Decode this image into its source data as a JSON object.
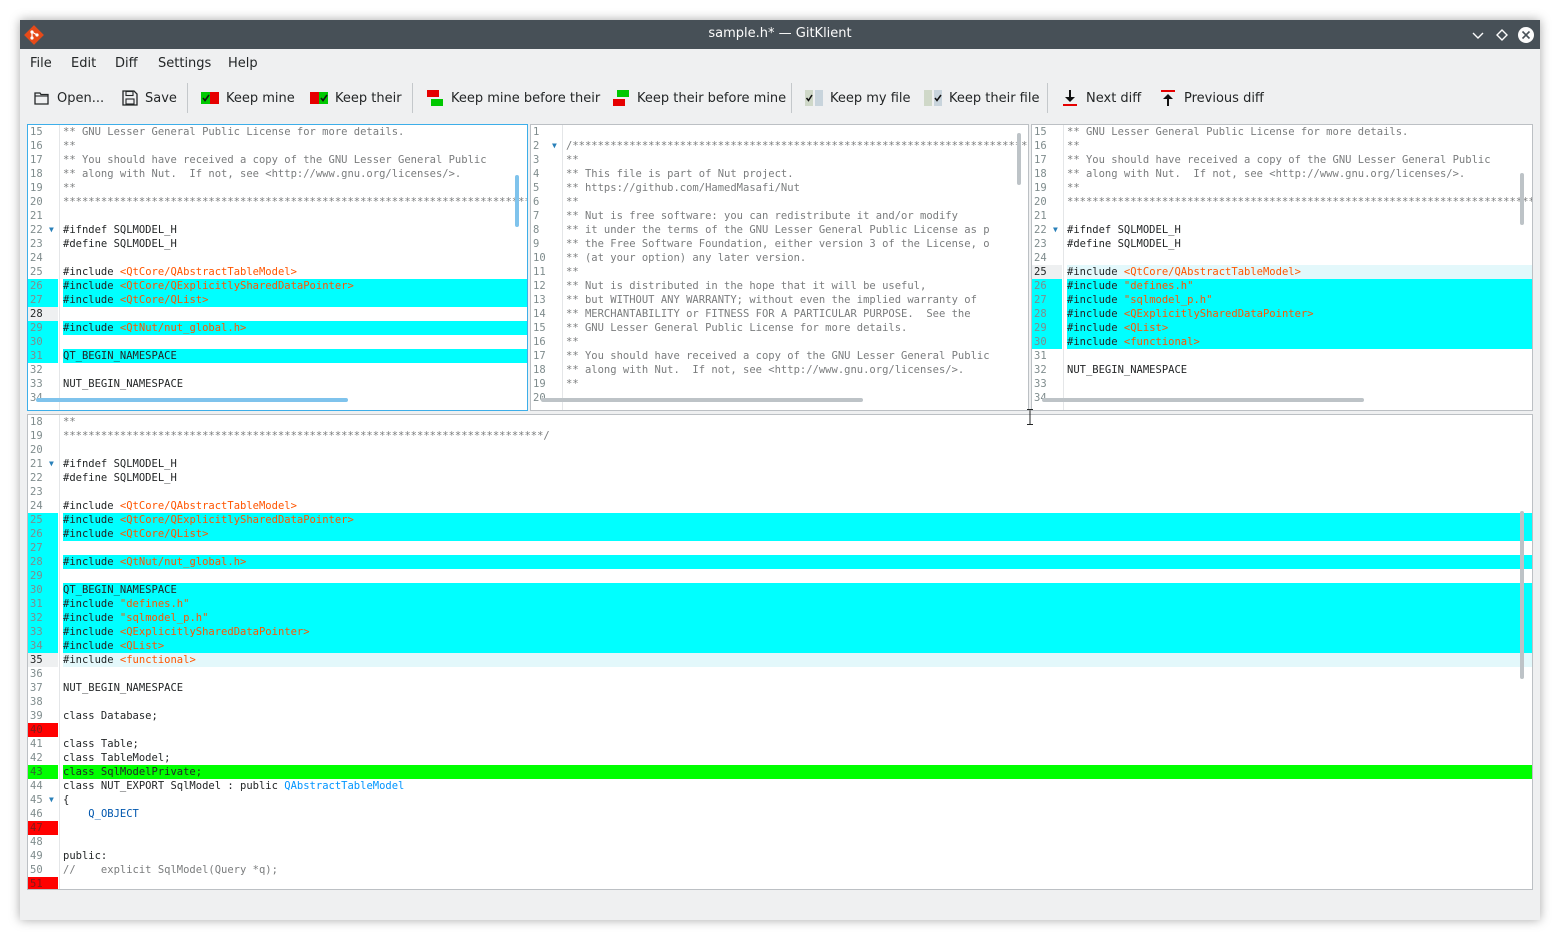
{
  "window": {
    "title": "sample.h* — GitKlient",
    "accent_color": "#3daee9"
  },
  "menu": [
    "File",
    "Edit",
    "Diff",
    "Settings",
    "Help"
  ],
  "toolbar": {
    "open": "Open...",
    "save": "Save",
    "keep_mine": "Keep mine",
    "keep_their": "Keep their",
    "keep_mine_before_their": "Keep mine before their",
    "keep_their_before_mine": "Keep their before mine",
    "keep_my_file": "Keep my file",
    "keep_their_file": "Keep their file",
    "next_diff": "Next diff",
    "previous_diff": "Previous diff"
  },
  "colors": {
    "changed": "#00ffff",
    "removed": "#ff0000",
    "added": "#00ff00",
    "current_line": "#e3f8fb"
  },
  "panes": {
    "mine": {
      "lines": [
        {
          "n": "15",
          "t": "** GNU Lesser General Public License for more details.",
          "s": "com"
        },
        {
          "n": "16",
          "t": "**",
          "s": "com"
        },
        {
          "n": "17",
          "t": "** You should have received a copy of the GNU Lesser General Public",
          "s": "com"
        },
        {
          "n": "18",
          "t": "** along with Nut.  If not, see <http://www.gnu.org/licenses/>.",
          "s": "com"
        },
        {
          "n": "19",
          "t": "**",
          "s": "com"
        },
        {
          "n": "20",
          "t": "****************************************************************************",
          "s": "com"
        },
        {
          "n": "21",
          "t": ""
        },
        {
          "n": "22",
          "t": "#ifndef SQLMODEL_H",
          "fold": true
        },
        {
          "n": "23",
          "t": "#define SQLMODEL_H"
        },
        {
          "n": "24",
          "t": ""
        },
        {
          "n": "25",
          "t": "#include ",
          "inc": "<QtCore/QAbstractTableModel>"
        },
        {
          "n": "26",
          "t": "#include ",
          "inc": "<QtCore/QExplicitlySharedDataPointer>",
          "hl": "cyan"
        },
        {
          "n": "27",
          "t": "#include ",
          "inc": "<QtCore/QList>",
          "hl": "cyan"
        },
        {
          "n": "28",
          "t": "",
          "hl": "cur"
        },
        {
          "n": "29",
          "t": "#include ",
          "inc": "<QtNut/nut_global.h>",
          "hl": "cyan"
        },
        {
          "n": "30",
          "t": "",
          "hl": "cyan"
        },
        {
          "n": "31",
          "t": "QT_BEGIN_NAMESPACE",
          "hl": "cyan"
        },
        {
          "n": "32",
          "t": ""
        },
        {
          "n": "33",
          "t": "NUT_BEGIN_NAMESPACE"
        },
        {
          "n": "34",
          "t": ""
        }
      ]
    },
    "base": {
      "lines": [
        {
          "n": "1",
          "t": ""
        },
        {
          "n": "2",
          "t": "/****************************************************************************",
          "s": "com",
          "fold": true
        },
        {
          "n": "3",
          "t": "**",
          "s": "com"
        },
        {
          "n": "4",
          "t": "** This file is part of Nut project.",
          "s": "com"
        },
        {
          "n": "5",
          "t": "** https://github.com/HamedMasafi/Nut",
          "s": "com"
        },
        {
          "n": "6",
          "t": "**",
          "s": "com"
        },
        {
          "n": "7",
          "t": "** Nut is free software: you can redistribute it and/or modify",
          "s": "com"
        },
        {
          "n": "8",
          "t": "** it under the terms of the GNU Lesser General Public License as p",
          "s": "com"
        },
        {
          "n": "9",
          "t": "** the Free Software Foundation, either version 3 of the License, o",
          "s": "com"
        },
        {
          "n": "10",
          "t": "** (at your option) any later version.",
          "s": "com"
        },
        {
          "n": "11",
          "t": "**",
          "s": "com"
        },
        {
          "n": "12",
          "t": "** Nut is distributed in the hope that it will be useful,",
          "s": "com"
        },
        {
          "n": "13",
          "t": "** but WITHOUT ANY WARRANTY; without even the implied warranty of",
          "s": "com"
        },
        {
          "n": "14",
          "t": "** MERCHANTABILITY or FITNESS FOR A PARTICULAR PURPOSE.  See the",
          "s": "com"
        },
        {
          "n": "15",
          "t": "** GNU Lesser General Public License for more details.",
          "s": "com"
        },
        {
          "n": "16",
          "t": "**",
          "s": "com"
        },
        {
          "n": "17",
          "t": "** You should have received a copy of the GNU Lesser General Public",
          "s": "com"
        },
        {
          "n": "18",
          "t": "** along with Nut.  If not, see <http://www.gnu.org/licenses/>.",
          "s": "com"
        },
        {
          "n": "19",
          "t": "**",
          "s": "com"
        },
        {
          "n": "20",
          "t": ""
        }
      ]
    },
    "their": {
      "lines": [
        {
          "n": "15",
          "t": "** GNU Lesser General Public License for more details.",
          "s": "com"
        },
        {
          "n": "16",
          "t": "**",
          "s": "com"
        },
        {
          "n": "17",
          "t": "** You should have received a copy of the GNU Lesser General Public",
          "s": "com"
        },
        {
          "n": "18",
          "t": "** along with Nut.  If not, see <http://www.gnu.org/licenses/>.",
          "s": "com"
        },
        {
          "n": "19",
          "t": "**",
          "s": "com"
        },
        {
          "n": "20",
          "t": "****************************************************************************",
          "s": "com"
        },
        {
          "n": "21",
          "t": ""
        },
        {
          "n": "22",
          "t": "#ifndef SQLMODEL_H",
          "fold": true
        },
        {
          "n": "23",
          "t": "#define SQLMODEL_H"
        },
        {
          "n": "24",
          "t": ""
        },
        {
          "n": "25",
          "t": "#include ",
          "inc": "<QtCore/QAbstractTableModel>",
          "hl": "cur"
        },
        {
          "n": "26",
          "t": "#include ",
          "inc": "\"defines.h\"",
          "hl": "cyan"
        },
        {
          "n": "27",
          "t": "#include ",
          "inc": "\"sqlmodel_p.h\"",
          "hl": "cyan"
        },
        {
          "n": "28",
          "t": "#include ",
          "inc": "<QExplicitlySharedDataPointer>",
          "hl": "cyan"
        },
        {
          "n": "29",
          "t": "#include ",
          "inc": "<QList>",
          "hl": "cyan"
        },
        {
          "n": "30",
          "t": "#include ",
          "inc": "<functional>",
          "hl": "cyan"
        },
        {
          "n": "31",
          "t": ""
        },
        {
          "n": "32",
          "t": "NUT_BEGIN_NAMESPACE"
        },
        {
          "n": "33",
          "t": ""
        },
        {
          "n": "34",
          "t": ""
        }
      ]
    },
    "result": {
      "lines": [
        {
          "n": "18",
          "t": "**",
          "s": "com"
        },
        {
          "n": "19",
          "t": "****************************************************************************/",
          "s": "com"
        },
        {
          "n": "20",
          "t": ""
        },
        {
          "n": "21",
          "t": "#ifndef SQLMODEL_H",
          "fold": true
        },
        {
          "n": "22",
          "t": "#define SQLMODEL_H"
        },
        {
          "n": "23",
          "t": ""
        },
        {
          "n": "24",
          "t": "#include ",
          "inc": "<QtCore/QAbstractTableModel>"
        },
        {
          "n": "25",
          "t": "#include ",
          "inc": "<QtCore/QExplicitlySharedDataPointer>",
          "hl": "cyan"
        },
        {
          "n": "26",
          "t": "#include ",
          "inc": "<QtCore/QList>",
          "hl": "cyan"
        },
        {
          "n": "27",
          "t": "",
          "hl": "cyan"
        },
        {
          "n": "28",
          "t": "#include ",
          "inc": "<QtNut/nut_global.h>",
          "hl": "cyan"
        },
        {
          "n": "29",
          "t": "",
          "hl": "cyan"
        },
        {
          "n": "30",
          "t": "QT_BEGIN_NAMESPACE",
          "hl": "cyan"
        },
        {
          "n": "31",
          "t": "#include ",
          "inc": "\"defines.h\"",
          "hl": "cyan"
        },
        {
          "n": "32",
          "t": "#include ",
          "inc": "\"sqlmodel_p.h\"",
          "hl": "cyan"
        },
        {
          "n": "33",
          "t": "#include ",
          "inc": "<QExplicitlySharedDataPointer>",
          "hl": "cyan"
        },
        {
          "n": "34",
          "t": "#include ",
          "inc": "<QList>",
          "hl": "cyan"
        },
        {
          "n": "35",
          "t": "#include ",
          "inc": "<functional>",
          "hl": "cur"
        },
        {
          "n": "36",
          "t": ""
        },
        {
          "n": "37",
          "t": "NUT_BEGIN_NAMESPACE"
        },
        {
          "n": "38",
          "t": ""
        },
        {
          "n": "39",
          "t": "class Database;"
        },
        {
          "n": "40",
          "t": "",
          "hl": "red"
        },
        {
          "n": "41",
          "t": "class Table;"
        },
        {
          "n": "42",
          "t": "class TableModel;"
        },
        {
          "n": "43",
          "t": "class SqlModelPrivate;",
          "hl": "green"
        },
        {
          "n": "44",
          "t": "class NUT_EXPORT SqlModel : public ",
          "cls": "QAbstractTableModel"
        },
        {
          "n": "45",
          "t": "{",
          "fold": true
        },
        {
          "n": "46",
          "t": "    ",
          "kw": "Q_OBJECT"
        },
        {
          "n": "47",
          "t": "",
          "hl": "red"
        },
        {
          "n": "48",
          "t": ""
        },
        {
          "n": "49",
          "t": "public:"
        },
        {
          "n": "50",
          "t": "//    explicit SqlModel(Query *q);",
          "s": "com"
        },
        {
          "n": "51",
          "t": "",
          "hl": "red"
        }
      ]
    }
  }
}
